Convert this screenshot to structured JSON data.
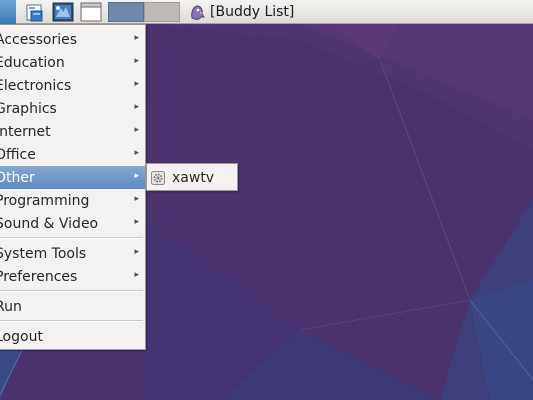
{
  "panel": {
    "buttons": [
      {
        "name": "application-menu",
        "icon": "menu-icon"
      },
      {
        "name": "file-manager",
        "icon": "folder-icon"
      },
      {
        "name": "tv-viewer",
        "icon": "tv-icon"
      },
      {
        "name": "show-desktop",
        "icon": "window-icon"
      }
    ],
    "workspaces": [
      "workspace-1",
      "workspace-2"
    ],
    "tasks": [
      {
        "label": "[Buddy List]",
        "icon": "pidgin-icon"
      }
    ]
  },
  "menu": {
    "items": [
      {
        "label": "Accessories",
        "submenu": true
      },
      {
        "label": "Education",
        "submenu": true
      },
      {
        "label": "Electronics",
        "submenu": true
      },
      {
        "label": "Graphics",
        "submenu": true
      },
      {
        "label": "Internet",
        "submenu": true
      },
      {
        "label": "Office",
        "submenu": true
      },
      {
        "label": "Other",
        "submenu": true,
        "selected": true
      },
      {
        "label": "Programming",
        "submenu": true
      },
      {
        "label": "Sound & Video",
        "submenu": true
      },
      {
        "label": "System Tools",
        "submenu": true
      },
      {
        "label": "Preferences",
        "submenu": true
      },
      {
        "label": "Run",
        "submenu": false
      },
      {
        "label": "Logout",
        "submenu": false
      }
    ],
    "arrow_glyph": "▸"
  },
  "submenu": {
    "parent": "Other",
    "items": [
      {
        "label": "xawtv",
        "icon": "gear-icon"
      }
    ]
  },
  "colors": {
    "wallpaper": "#4a336e",
    "selection": "#6f95c6",
    "menu_bg": "#f3f2f0"
  }
}
